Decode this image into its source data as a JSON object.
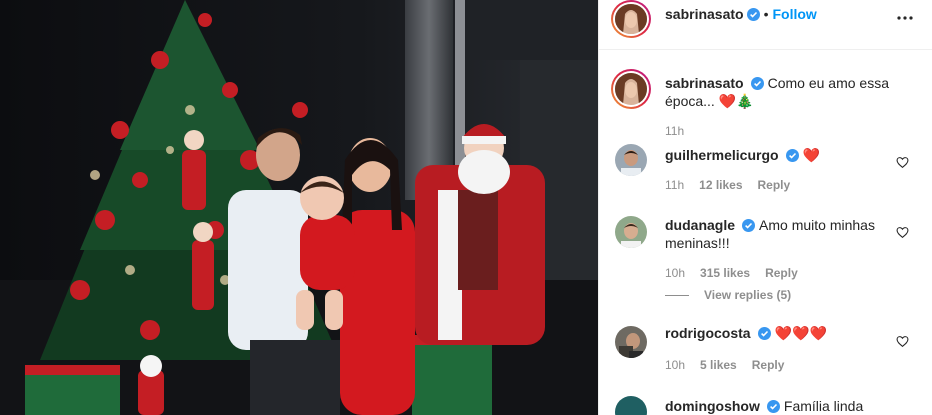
{
  "post": {
    "author": "sabrinasato",
    "follow_label": "Follow",
    "separator": "•",
    "more_icon": "more-options-icon"
  },
  "caption": {
    "username": "sabrinasato",
    "text": "Como eu amo essa época... ❤️🎄",
    "time": "11h"
  },
  "comments": [
    {
      "username": "guilhermelicurgo",
      "text": "❤️",
      "time": "11h",
      "likes": "12 likes",
      "reply": "Reply"
    },
    {
      "username": "dudanagle",
      "text": "Amo muito minhas meninas!!!",
      "time": "10h",
      "likes": "315 likes",
      "reply": "Reply",
      "view_replies": "View replies (5)"
    },
    {
      "username": "rodrigocosta",
      "text": "❤️❤️❤️",
      "time": "10h",
      "likes": "5 likes",
      "reply": "Reply"
    },
    {
      "username": "domingoshow",
      "text": "Família linda"
    }
  ],
  "colors": {
    "link": "#0095f6",
    "muted": "#8e8e8e",
    "verified": "#3897f0"
  }
}
